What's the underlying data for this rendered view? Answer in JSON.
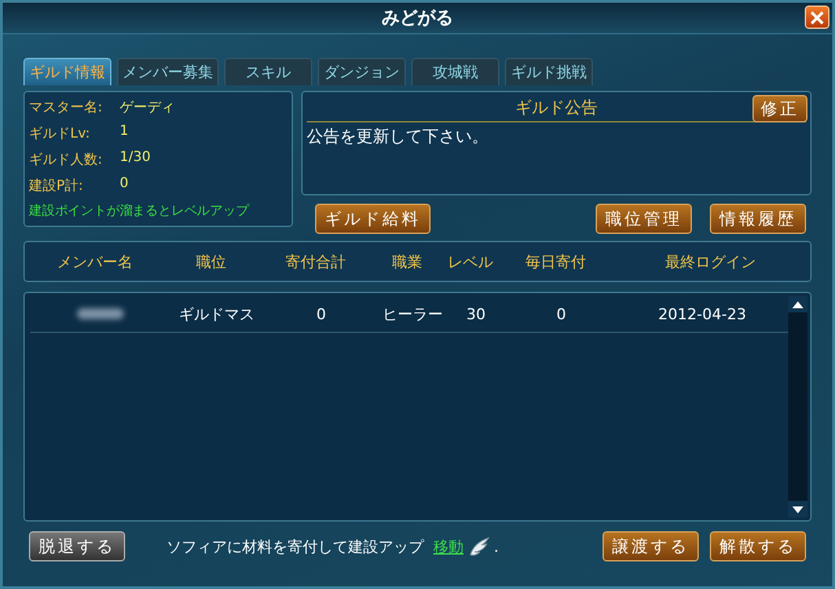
{
  "window": {
    "title": "みどがる"
  },
  "tabs": [
    {
      "label": "ギルド情報",
      "selected": true
    },
    {
      "label": "メンバー募集",
      "selected": false
    },
    {
      "label": "スキル",
      "selected": false
    },
    {
      "label": "ダンジョン",
      "selected": false
    },
    {
      "label": "攻城戦",
      "selected": false
    },
    {
      "label": "ギルド挑戦",
      "selected": false
    }
  ],
  "guild_info": {
    "fields": [
      {
        "label": "マスター名:",
        "value": "ゲーディ"
      },
      {
        "label": "ギルドLv:",
        "value": "1"
      },
      {
        "label": "ギルド人数:",
        "value": "1/30"
      },
      {
        "label": "建設P計:",
        "value": "0"
      }
    ],
    "hint": "建設ポイントが溜まるとレベルアップ"
  },
  "notice": {
    "title": "ギルド公告",
    "edit_button": "修正",
    "text": "公告を更新して下さい。"
  },
  "salary_button": "ギルド給料",
  "right_buttons": [
    "職位管理",
    "情報履歴"
  ],
  "table": {
    "columns": [
      "メンバー名",
      "職位",
      "寄付合計",
      "職業",
      "レベル",
      "毎日寄付",
      "最終ログイン"
    ],
    "rows": [
      {
        "cells": [
          "",
          "ギルドマス",
          "0",
          "ヒーラー",
          "30",
          "0",
          "2012-04-23"
        ]
      }
    ]
  },
  "footer": {
    "leave_button": "脱退する",
    "message": "ソフィアに材料を寄付して建設アップ",
    "link": "移動",
    "trailing": ".",
    "right_buttons": [
      "譲渡する",
      "解散する"
    ]
  }
}
